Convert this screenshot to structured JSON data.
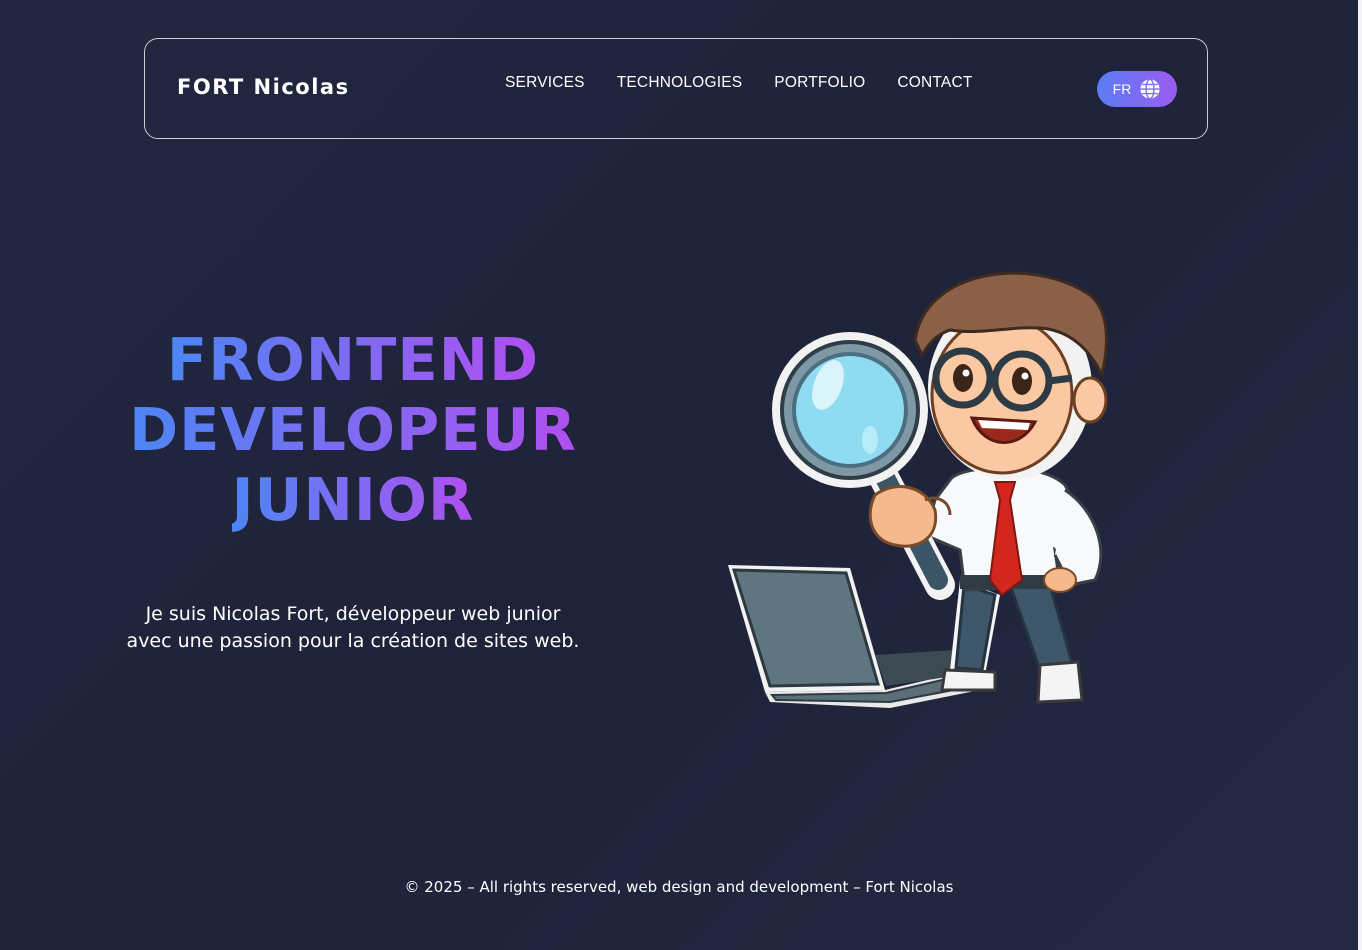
{
  "header": {
    "brand": "FORT Nicolas",
    "nav": {
      "services": "SERVICES",
      "technologies": "TECHNOLOGIES",
      "portfolio": "PORTFOLIO",
      "contact": "CONTACT"
    },
    "language": {
      "label": "FR",
      "icon": "globe-icon"
    }
  },
  "hero": {
    "title_lines": [
      "FRONTEND",
      "DEVELOPEUR",
      "JUNIOR"
    ],
    "description_lines": [
      "Je suis Nicolas Fort, développeur web junior",
      "avec une passion pour la création de sites web."
    ],
    "illustration": "developer-with-magnifier-and-laptop"
  },
  "footer": {
    "copyright": "© 2025 – All rights reserved, web design and development – Fort Nicolas"
  },
  "colors": {
    "background": "#222640",
    "gradient_start": "#4c86f5",
    "gradient_end": "#b14ff0",
    "button_gradient_start": "#5b7cf5",
    "button_gradient_end": "#9a5cf0"
  }
}
